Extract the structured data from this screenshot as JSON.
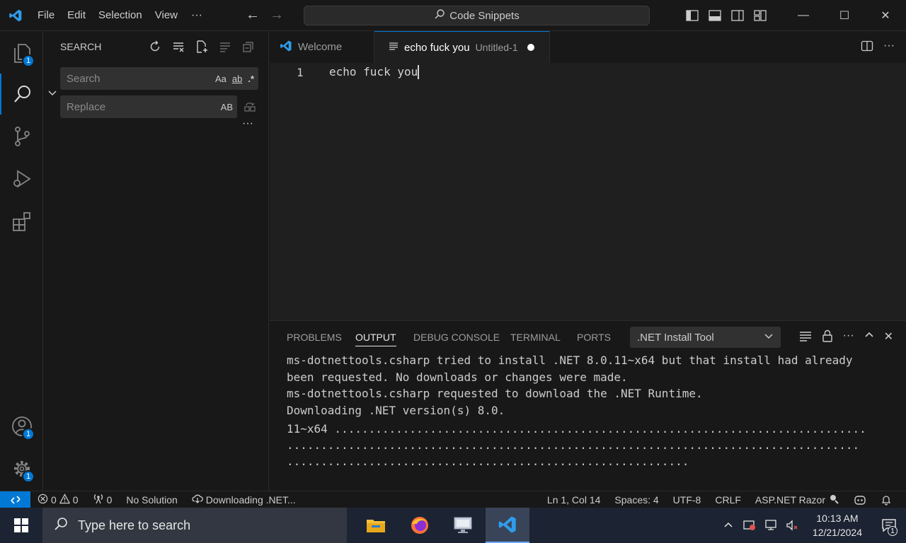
{
  "menu": [
    "File",
    "Edit",
    "Selection",
    "View"
  ],
  "menu_more": "···",
  "command_center": {
    "label": "Code Snippets"
  },
  "activity": {
    "explorer_badge": "1",
    "accounts_badge": "1",
    "manage_badge": "1"
  },
  "sidebar": {
    "title": "SEARCH",
    "search_placeholder": "Search",
    "replace_placeholder": "Replace",
    "opt_case": "Aa",
    "opt_word": "ab",
    "opt_regex": ".*",
    "opt_preserve_case": "AB",
    "more": "···"
  },
  "tabs": [
    {
      "label": "Welcome"
    },
    {
      "label": "echo fuck you",
      "sub": "Untitled-1"
    }
  ],
  "editor": {
    "line_number": "1",
    "line_text": "echo fuck you"
  },
  "panel": {
    "tabs": [
      "PROBLEMS",
      "OUTPUT",
      "DEBUG CONSOLE",
      "TERMINAL",
      "PORTS"
    ],
    "active_tab": "OUTPUT",
    "channel": ".NET Install Tool",
    "lines": [
      "ms-dotnettools.csharp tried to install .NET 8.0.11~x64 but that install had already",
      "been requested. No downloads or changes were made.",
      "ms-dotnettools.csharp requested to download the .NET Runtime.",
      "Downloading .NET version(s) 8.0.",
      "11~x64 ..............................................................................",
      "....................................................................................",
      "..........................................................."
    ]
  },
  "status": {
    "errors": "0",
    "warnings": "0",
    "ports": "0",
    "solution": "No Solution",
    "downloading": "Downloading .NET...",
    "position": "Ln 1, Col 14",
    "spaces": "Spaces: 4",
    "encoding": "UTF-8",
    "eol": "CRLF",
    "language": "ASP.NET Razor"
  },
  "taskbar": {
    "search_placeholder": "Type here to search",
    "time": "10:13 AM",
    "date": "12/21/2024",
    "notification_count": "1"
  },
  "colors": {
    "accent": "#0078d4",
    "statusbar_remote": "#0078d4",
    "taskbar": "#1c2433"
  }
}
